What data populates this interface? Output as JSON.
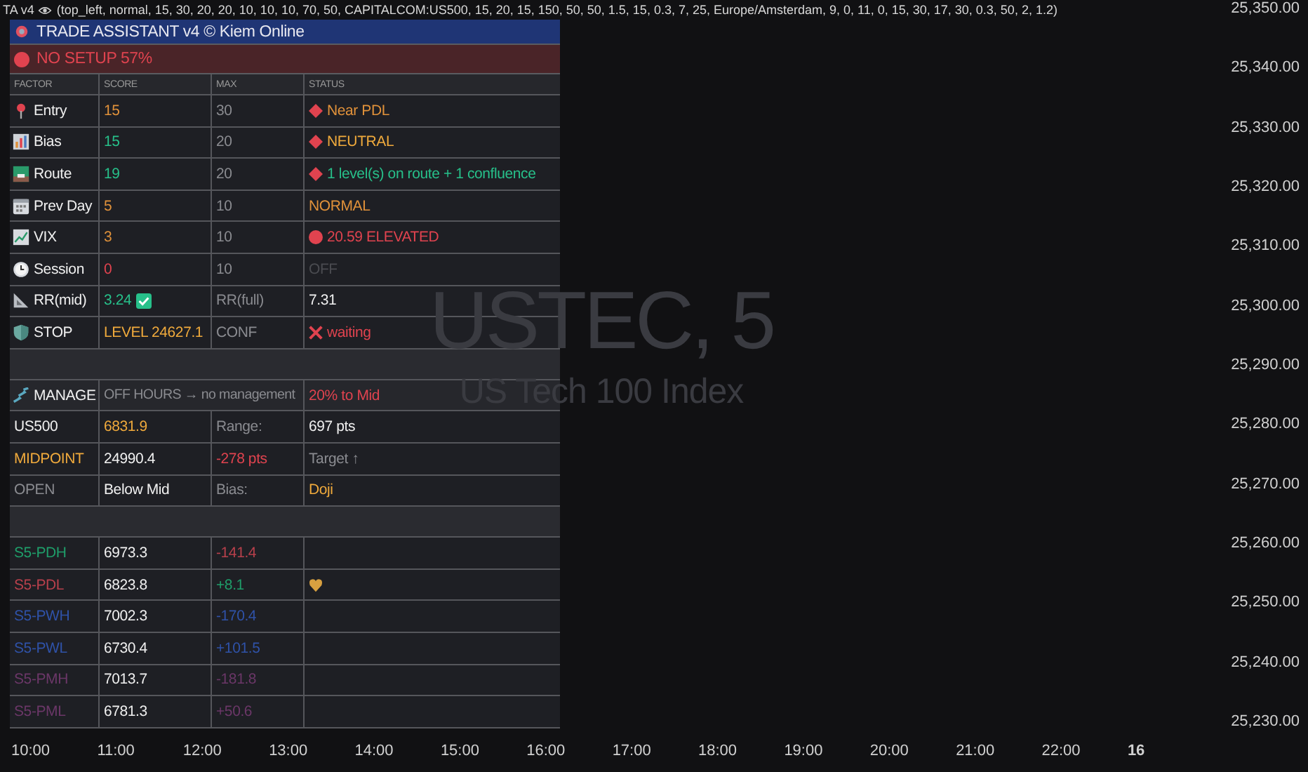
{
  "legend": {
    "name": "TA v4",
    "params": "(top_left, normal, 15, 30, 20, 20, 10, 10, 10, 70, 50, CAPITALCOM:US500, 15, 20, 15, 150, 50, 50, 1.5, 15, 0.3, 7, 25, Europe/Amsterdam, 9, 0, 11, 0, 15, 30, 17, 30, 0.3, 50, 2, 1.2)"
  },
  "watermark": {
    "symbol": "USTEC, 5",
    "description": "US Tech 100 Index"
  },
  "panel": {
    "title": "TRADE ASSISTANT v4 © Kiem Online",
    "banner": "NO SETUP 57%",
    "columns": [
      "FACTOR",
      "SCORE",
      "MAX",
      "STATUS"
    ],
    "factors": [
      {
        "name": "Entry",
        "score": {
          "text": "15",
          "color": "#e0913a"
        },
        "max": "30",
        "status": {
          "text": "Near PDL",
          "color": "#e0913a",
          "kind": "diamond"
        }
      },
      {
        "name": "Bias",
        "score": {
          "text": "15",
          "color": "#27c08a"
        },
        "max": "20",
        "status": {
          "text": "NEUTRAL",
          "color": "#f0aa3c",
          "kind": "diamond"
        }
      },
      {
        "name": "Route",
        "score": {
          "text": "19",
          "color": "#27c08a"
        },
        "max": "20",
        "status": {
          "text": "1 level(s) on route + 1 confluence",
          "color": "#27c08a",
          "kind": "diamond"
        }
      },
      {
        "name": "Prev Day",
        "score": {
          "text": "5",
          "color": "#e0913a"
        },
        "max": "10",
        "status": {
          "text": "NORMAL",
          "color": "#e0913a",
          "kind": "plain"
        }
      },
      {
        "name": "VIX",
        "score": {
          "text": "3",
          "color": "#e0913a"
        },
        "max": "10",
        "status": {
          "text": "20.59 ELEVATED",
          "color": "#e0434f",
          "kind": "dot"
        }
      },
      {
        "name": "Session",
        "score": {
          "text": "0",
          "color": "#e0434f"
        },
        "max": "10",
        "status": {
          "text": "OFF",
          "color": "#4a4b50",
          "kind": "plain"
        }
      },
      {
        "name": "RR(mid)",
        "score": {
          "text": "3.24",
          "color": "#27c08a",
          "checked": true
        },
        "max": "RR(full)",
        "status": {
          "text": "7.31",
          "color": "#f0f0f0",
          "kind": "plain"
        }
      },
      {
        "name": "STOP",
        "score": {
          "text": "LEVEL 24627.1",
          "color": "#f0aa3c"
        },
        "max": "CONF",
        "status": {
          "text": "waiting",
          "color": "#e0434f",
          "kind": "cross"
        }
      }
    ],
    "manage": {
      "label": "MANAGE",
      "state": "OFF HOURS → no management",
      "target": "20% to Mid"
    },
    "info_rows": [
      {
        "cells": [
          {
            "text": "US500",
            "color": "#f0f0f0"
          },
          {
            "text": "6831.9",
            "color": "#f0aa3c"
          },
          {
            "text": "Range:",
            "color": "#8a8b90"
          },
          {
            "text": "697 pts",
            "color": "#f0f0f0"
          }
        ]
      },
      {
        "cells": [
          {
            "text": "MIDPOINT",
            "color": "#f0aa3c"
          },
          {
            "text": "24990.4",
            "color": "#f0f0f0"
          },
          {
            "text": "-278 pts",
            "color": "#e0434f"
          },
          {
            "text": "Target ↑",
            "color": "#8a8b90"
          }
        ]
      },
      {
        "cells": [
          {
            "text": "OPEN",
            "color": "#8a8b90"
          },
          {
            "text": "Below Mid",
            "color": "#f0f0f0"
          },
          {
            "text": "Bias:",
            "color": "#8a8b90"
          },
          {
            "text": "Doji",
            "color": "#f0aa3c"
          }
        ]
      }
    ],
    "levels": [
      {
        "name": {
          "text": "S5-PDH",
          "color": "#1f9e6a"
        },
        "value": "6973.3",
        "distance": {
          "text": "-141.4",
          "color": "#b8404c"
        },
        "flagged": false
      },
      {
        "name": {
          "text": "S5-PDL",
          "color": "#b8404c"
        },
        "value": "6823.8",
        "distance": {
          "text": "+8.1",
          "color": "#1f9e6a"
        },
        "flagged": true
      },
      {
        "name": {
          "text": "S5-PWH",
          "color": "#2f52a8"
        },
        "value": "7002.3",
        "distance": {
          "text": "-170.4",
          "color": "#2f52a8"
        },
        "flagged": false
      },
      {
        "name": {
          "text": "S5-PWL",
          "color": "#2f52a8"
        },
        "value": "6730.4",
        "distance": {
          "text": "+101.5",
          "color": "#2f52a8"
        },
        "flagged": false
      },
      {
        "name": {
          "text": "S5-PMH",
          "color": "#6b3768"
        },
        "value": "7013.7",
        "distance": {
          "text": "-181.8",
          "color": "#6b3768"
        },
        "flagged": false
      },
      {
        "name": {
          "text": "S5-PML",
          "color": "#6b3768"
        },
        "value": "6781.3",
        "distance": {
          "text": "+50.6",
          "color": "#6b3768"
        },
        "flagged": false
      }
    ]
  },
  "price_axis": [
    "25,350.00",
    "25,340.00",
    "25,330.00",
    "25,320.00",
    "25,310.00",
    "25,300.00",
    "25,290.00",
    "25,280.00",
    "25,270.00",
    "25,260.00",
    "25,250.00",
    "25,240.00",
    "25,230.00"
  ],
  "time_axis": [
    {
      "label": "10:00",
      "kind": "time"
    },
    {
      "label": "11:00",
      "kind": "time"
    },
    {
      "label": "12:00",
      "kind": "time"
    },
    {
      "label": "13:00",
      "kind": "time"
    },
    {
      "label": "14:00",
      "kind": "time"
    },
    {
      "label": "15:00",
      "kind": "time"
    },
    {
      "label": "16:00",
      "kind": "time"
    },
    {
      "label": "17:00",
      "kind": "time"
    },
    {
      "label": "18:00",
      "kind": "time"
    },
    {
      "label": "19:00",
      "kind": "time"
    },
    {
      "label": "20:00",
      "kind": "time"
    },
    {
      "label": "21:00",
      "kind": "time"
    },
    {
      "label": "22:00",
      "kind": "time"
    },
    {
      "label": "16",
      "kind": "day"
    }
  ]
}
